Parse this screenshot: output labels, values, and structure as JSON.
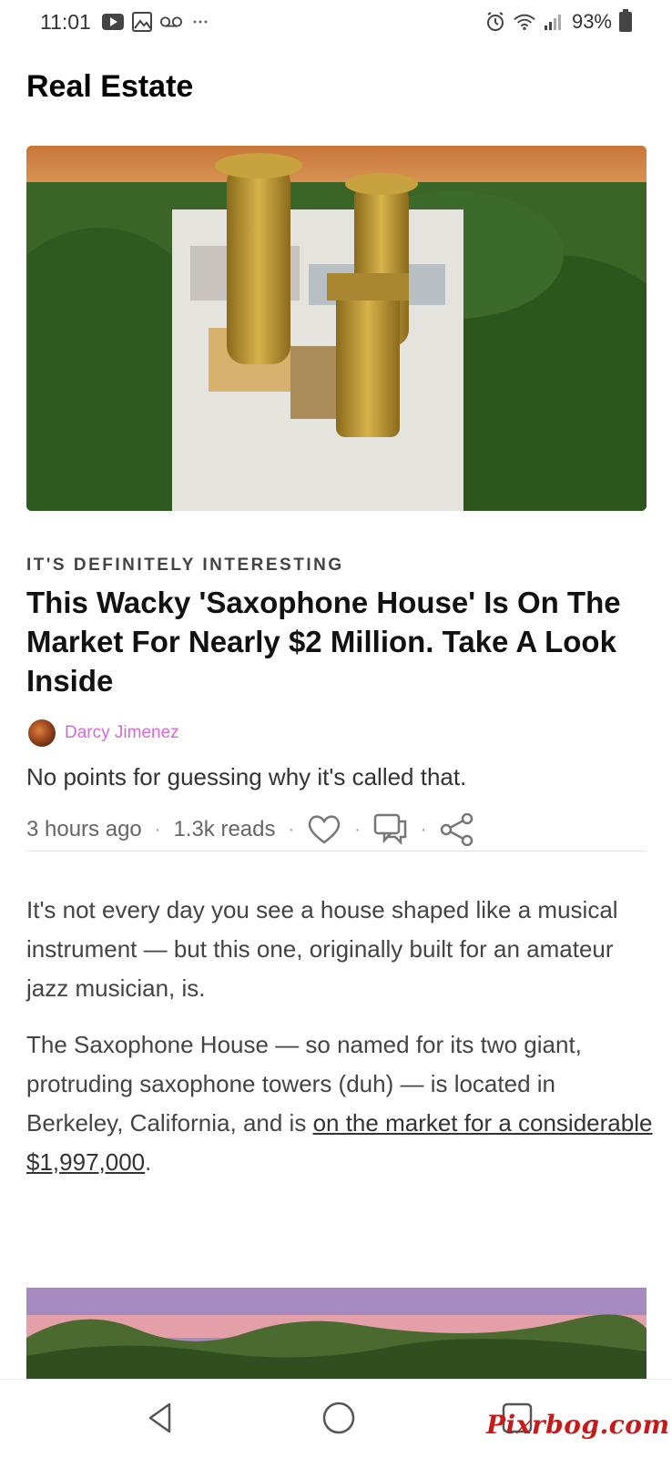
{
  "status_bar": {
    "time": "11:01",
    "left_icons": [
      "youtube-icon",
      "image-icon",
      "voicemail-icon",
      "more-icon"
    ],
    "right_icons": [
      "alarm-icon",
      "wifi-icon",
      "signal-icon"
    ],
    "battery": "93%"
  },
  "header": {
    "title": "Real Estate"
  },
  "article": {
    "kicker": "IT'S DEFINITELY INTERESTING",
    "headline": "This Wacky 'Saxophone House' Is On The Market For Nearly $2 Million. Take A Look Inside",
    "author": "Darcy Jimenez",
    "dek": "No points for guessing why it's called that.",
    "meta": {
      "time_ago": "3 hours ago",
      "reads": "1.3k reads",
      "separator": "·"
    },
    "body": {
      "p1": "It's not every day you see a house shaped like a musical instrument — but this one, originally built for an amateur jazz musician, is.",
      "p2_start": "The Saxophone House — so named for its two giant, protruding saxophone towers (duh) — is located in Berkeley, California, and is ",
      "p2_link": "on the market for a considerable $1,997,000",
      "p2_end": "."
    }
  },
  "nav_bar": {
    "buttons": [
      "back-icon",
      "home-icon",
      "recent-apps-icon"
    ]
  },
  "watermark": "Pixrbog.com",
  "colors": {
    "author": "#d46ad8",
    "watermark": "#c41b1b",
    "text": "#444444"
  }
}
